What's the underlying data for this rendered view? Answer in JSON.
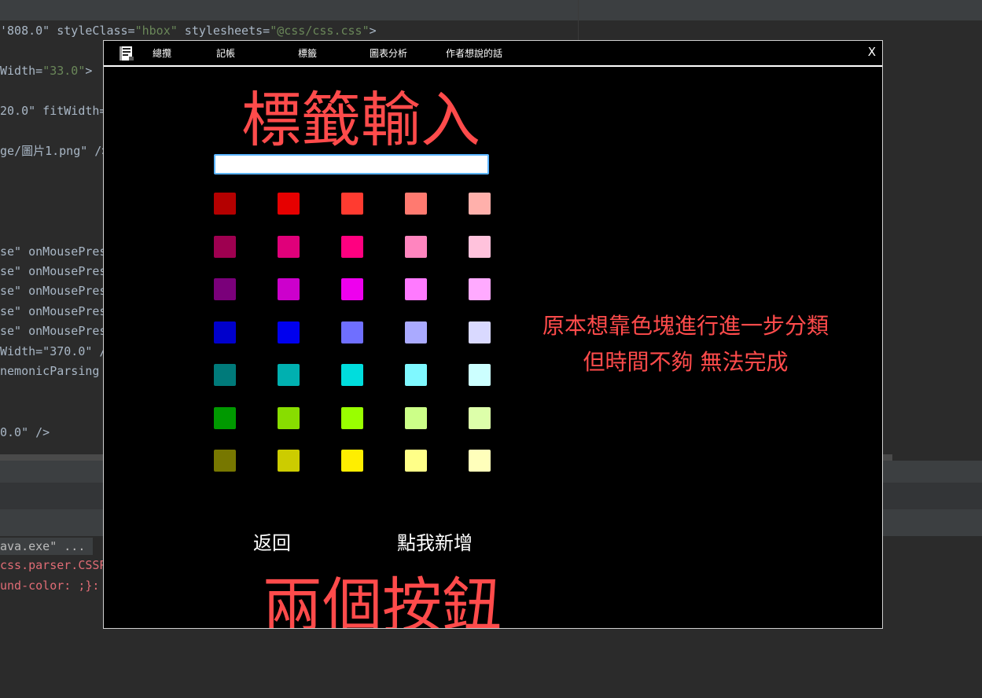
{
  "ide": {
    "code_lines": [
      {
        "pre": "'808.0\" styleClass=",
        "s1": "\"hbox\"",
        "mid": " stylesheets=",
        "s2": "\"@css/css.css\"",
        "post": ">"
      },
      {
        "pre": "Width=",
        "s1": "\"33.0\"",
        "mid": ">",
        "s2": "",
        "post": ""
      },
      {
        "pre": "20.0\" fitWidth=",
        "s1": "",
        "mid": "",
        "s2": "",
        "post": ""
      },
      {
        "pre": "ge/圖片1.png\" />",
        "s1": "",
        "mid": "",
        "s2": "",
        "post": ""
      },
      {
        "pre": "se\" onMousePres",
        "s1": "",
        "mid": "",
        "s2": "",
        "post": ""
      },
      {
        "pre": "se\" onMousePres",
        "s1": "",
        "mid": "",
        "s2": "",
        "post": ""
      },
      {
        "pre": "se\" onMousePres",
        "s1": "",
        "mid": "",
        "s2": "",
        "post": ""
      },
      {
        "pre": "se\" onMousePres",
        "s1": "",
        "mid": "",
        "s2": "",
        "post": ""
      },
      {
        "pre": "se\" onMousePres",
        "s1": "",
        "mid": "",
        "s2": "",
        "post": ""
      },
      {
        "pre": "Width=\"370.0\" /",
        "s1": "",
        "mid": "",
        "s2": "",
        "post": ""
      },
      {
        "pre": "nemonicParsing",
        "s1": "",
        "mid": "",
        "s2": "",
        "post": ""
      },
      {
        "pre": "0.0\" />",
        "s1": "",
        "mid": "",
        "s2": "",
        "post": ""
      }
    ],
    "console": {
      "cmd": "ava.exe\" ...",
      "err1": "css.parser.CSSP",
      "err2": "und-color: ;}:"
    }
  },
  "app": {
    "menu": {
      "logo_icon": "book-icon",
      "items": [
        "總攬",
        "記帳",
        "標籤",
        "圖表分析",
        "作者想說的話"
      ],
      "close": "X"
    },
    "title_top": "標籤輸入",
    "input": {
      "value": "",
      "placeholder": ""
    },
    "swatches": [
      [
        "#b40000",
        "#e60000",
        "#ff3b30",
        "#ff7a70",
        "#ffb0ab"
      ],
      [
        "#9e0050",
        "#e0007a",
        "#ff0080",
        "#ff85bf",
        "#ffc2dc"
      ],
      [
        "#7a007a",
        "#cc00cc",
        "#ee00ee",
        "#ff7aff",
        "#ffaaff"
      ],
      [
        "#0000cc",
        "#0000ee",
        "#6f6fff",
        "#aaaaff",
        "#d9d9ff"
      ],
      [
        "#007a7a",
        "#00b0b0",
        "#00dddd",
        "#7ff8ff",
        "#ccffff"
      ],
      [
        "#009900",
        "#88dd00",
        "#99ff00",
        "#ccff88",
        "#ddffaa"
      ],
      [
        "#777700",
        "#cccc00",
        "#ffee00",
        "#ffff88",
        "#ffffbb"
      ]
    ],
    "note": {
      "line1": "原本想靠色塊進行進一步分類",
      "line2": "但時間不夠 無法完成"
    },
    "buttons": {
      "back": "返回",
      "add": "點我新增"
    },
    "title_bottom": "兩個按鈕",
    "accent_color": "#ff4b4b"
  }
}
